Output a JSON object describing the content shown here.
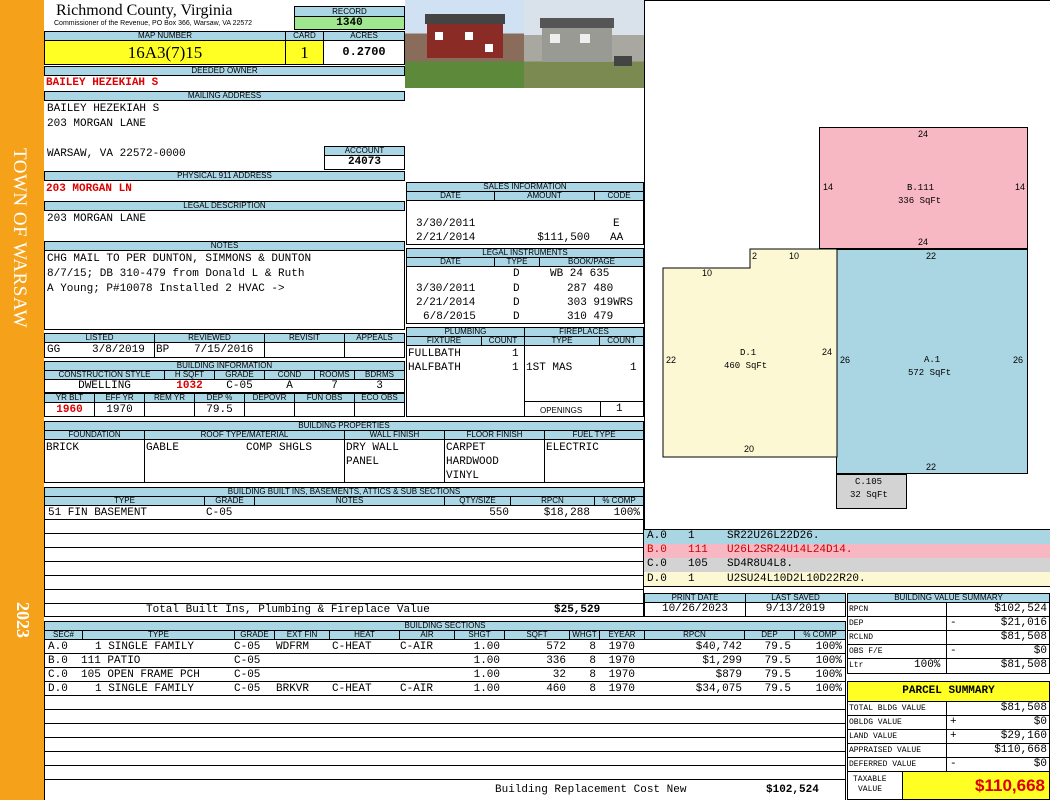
{
  "sidebar": {
    "town": "TOWN OF WARSAW",
    "year": "2023",
    "bg": "#f5a21a"
  },
  "header": {
    "county": "Richmond County, Virginia",
    "office": "Commissioner of the Revenue, PO Box 366, Warsaw, VA 22572",
    "record_label": "RECORD",
    "record": "1340",
    "map_label": "MAP NUMBER",
    "map_number": "16A3(7)15",
    "card_label": "CARD",
    "card": "1",
    "acres_label": "ACRES",
    "acres": "0.2700"
  },
  "owner": {
    "deeded_label": "DEEDED OWNER",
    "deeded": "BAILEY HEZEKIAH S",
    "mailing_label": "MAILING ADDRESS",
    "mailing_line1": "BAILEY HEZEKIAH S",
    "mailing_line2": "203 MORGAN LANE",
    "mailing_line3": "WARSAW, VA 22572-0000",
    "account_label": "ACCOUNT",
    "account": "24073",
    "physical_label": "PHYSICAL 911 ADDRESS",
    "physical": "203 MORGAN LN",
    "legal_label": "LEGAL DESCRIPTION",
    "legal": "203 MORGAN LANE",
    "notes_label": "NOTES",
    "notes_line1": "CHG MAIL TO PER DUNTON, SIMMONS & DUNTON",
    "notes_line2": "8/7/15; DB 310-479 from Donald L & Ruth",
    "notes_line3": "A Young; P#10078 Installed 2 HVAC ->"
  },
  "listing": {
    "listed_label": "LISTED",
    "reviewed_label": "REVIEWED",
    "revisit_label": "REVISIT",
    "appeals_label": "APPEALS",
    "listed_by": "GG",
    "listed_date": "3/8/2019",
    "reviewed_by": "BP",
    "reviewed_date": "7/15/2016"
  },
  "building_info": {
    "title": "BUILDING INFORMATION",
    "h_style": "CONSTRUCTION STYLE",
    "h_sqft": "H SQFT",
    "h_grade": "GRADE",
    "h_cond": "COND",
    "h_rooms": "ROOMS",
    "h_bdrms": "BDRMS",
    "style": "DWELLING",
    "sqft": "1032",
    "grade": "C-05",
    "cond": "A",
    "rooms": "7",
    "bdrms": "3",
    "h_yrblt": "YR BLT",
    "h_effyr": "EFF YR",
    "h_remyr": "REM YR",
    "h_dep": "DEP %",
    "h_depovr": "DEPOVR",
    "h_funobs": "FUN OBS",
    "h_ecoobs": "ECO OBS",
    "yrblt": "1960",
    "effyr": "1970",
    "dep": "79.5"
  },
  "sales": {
    "title": "SALES INFORMATION",
    "h_date": "DATE",
    "h_amount": "AMOUNT",
    "h_code": "CODE",
    "rows": [
      {
        "date": "3/30/2011",
        "amount": "",
        "code": "E"
      },
      {
        "date": "2/21/2014",
        "amount": "$111,500",
        "code": "AA"
      }
    ]
  },
  "legal_instruments": {
    "title": "LEGAL INSTRUMENTS",
    "h_date": "DATE",
    "h_type": "TYPE",
    "h_book": "BOOK/PAGE",
    "rows": [
      {
        "date": "",
        "type": "D",
        "book": "WB 24 635"
      },
      {
        "date": "3/30/2011",
        "type": "D",
        "book": "287 480"
      },
      {
        "date": "2/21/2014",
        "type": "D",
        "book": "303 919WRS"
      },
      {
        "date": "6/8/2015",
        "type": "D",
        "book": "310 479"
      }
    ]
  },
  "plumbing": {
    "title": "PLUMBING",
    "h_fixture": "FIXTURE",
    "h_count": "COUNT",
    "rows": [
      {
        "fixture": "FULLBATH",
        "count": "1"
      },
      {
        "fixture": "HALFBATH",
        "count": "1"
      }
    ]
  },
  "fireplaces": {
    "title": "FIREPLACES",
    "h_type": "TYPE",
    "h_count": "COUNT",
    "rows": [
      {
        "type": "1ST MAS",
        "count": "1"
      }
    ],
    "openings_label": "OPENINGS",
    "openings": "1"
  },
  "properties": {
    "title": "BUILDING PROPERTIES",
    "h_foundation": "FOUNDATION",
    "h_roof": "ROOF TYPE/MATERIAL",
    "h_wall": "WALL FINISH",
    "h_floor": "FLOOR FINISH",
    "h_fuel": "FUEL TYPE",
    "foundation": "BRICK",
    "roof_type": "GABLE",
    "roof_material": "COMP SHGLS",
    "wall1": "DRY WALL",
    "wall2": "PANEL",
    "floor1": "CARPET",
    "floor2": "HARDWOOD",
    "floor3": "VINYL",
    "fuel": "ELECTRIC"
  },
  "builtins": {
    "title": "BUILDING BUILT INS, BASEMENTS, ATTICS & SUB SECTIONS",
    "h_type": "TYPE",
    "h_grade": "GRADE",
    "h_notes": "NOTES",
    "h_qty": "QTY/SIZE",
    "h_rpcn": "RPCN",
    "h_comp": "% COMP",
    "rows": [
      {
        "type": "51 FIN BASEMENT",
        "grade": "C-05",
        "qty": "550",
        "rpcn": "$18,288",
        "comp": "100%"
      }
    ],
    "total_label": "Total Built Ins, Plumbing & Fireplace Value",
    "total": "$25,529"
  },
  "sections": {
    "title": "BUILDING SECTIONS",
    "h_sec": "SEC#",
    "h_type": "TYPE",
    "h_grade": "GRADE",
    "h_extfin": "EXT FIN",
    "h_heat": "HEAT",
    "h_air": "AIR",
    "h_shgt": "SHGT",
    "h_sqft": "SQFT",
    "h_whgt": "WHGT",
    "h_eyear": "EYEAR",
    "h_rpcn": "RPCN",
    "h_dep": "DEP",
    "h_comp": "% COMP",
    "rows": [
      {
        "sec": "A.0",
        "type": "1 SINGLE FAMILY",
        "grade": "C-05",
        "extfin": "WDFRM",
        "heat": "C-HEAT",
        "air": "C-AIR",
        "shgt": "1.00",
        "sqft": "572",
        "whgt": "8",
        "eyear": "1970",
        "rpcn": "$40,742",
        "dep": "79.5",
        "comp": "100%"
      },
      {
        "sec": "B.0",
        "type": "111 PATIO",
        "grade": "C-05",
        "extfin": "",
        "heat": "",
        "air": "",
        "shgt": "1.00",
        "sqft": "336",
        "whgt": "8",
        "eyear": "1970",
        "rpcn": "$1,299",
        "dep": "79.5",
        "comp": "100%"
      },
      {
        "sec": "C.0",
        "type": "105 OPEN FRAME PCH",
        "grade": "C-05",
        "extfin": "",
        "heat": "",
        "air": "",
        "shgt": "1.00",
        "sqft": "32",
        "whgt": "8",
        "eyear": "1970",
        "rpcn": "$879",
        "dep": "79.5",
        "comp": "100%"
      },
      {
        "sec": "D.0",
        "type": "1 SINGLE FAMILY",
        "grade": "C-05",
        "extfin": "BRKVR",
        "heat": "C-HEAT",
        "air": "C-AIR",
        "shgt": "1.00",
        "sqft": "460",
        "whgt": "8",
        "eyear": "1970",
        "rpcn": "$34,075",
        "dep": "79.5",
        "comp": "100%"
      }
    ],
    "total_label": "Building Replacement Cost New",
    "total": "$102,524"
  },
  "sketch": {
    "colors": {
      "b": "#f7b8c3",
      "d": "#fbf8d3",
      "a": "#aad5e3",
      "c": "#d3d3d3"
    },
    "b_label": "B.111",
    "b_area": "336 SqFt",
    "b_top": "24",
    "b_left": "14",
    "b_right": "14",
    "b_bottom": "24",
    "d_label": "D.1",
    "d_area": "460 SqFt",
    "d_10": "10",
    "d_2": "2",
    "d_10b": "10",
    "d_22": "22",
    "d_24": "24",
    "d_20": "20",
    "a_label": "A.1",
    "a_area": "572 SqFt",
    "a_22top": "22",
    "a_26l": "26",
    "a_26r": "26",
    "a_22b": "22",
    "c_label": "C.105",
    "c_area": "32 SqFt",
    "legend": [
      {
        "code": "A.0",
        "num": "1",
        "vec": "SR22U26L22D26.",
        "color": "#aad5e3"
      },
      {
        "code": "B.0",
        "num": "111",
        "vec": "U26L2SR24U14L24D14.",
        "color": "#f7b8c3"
      },
      {
        "code": "C.0",
        "num": "105",
        "vec": "SD4R8U4L8.",
        "color": "#d3d3d3"
      },
      {
        "code": "D.0",
        "num": "1",
        "vec": "U2SU24L10D2L10D22R20.",
        "color": "#fbf8d3"
      }
    ]
  },
  "dates": {
    "print_label": "PRINT DATE",
    "print": "10/26/2023",
    "saved_label": "LAST SAVED",
    "saved": "9/13/2019"
  },
  "value_summary": {
    "title": "BUILDING VALUE SUMMARY",
    "rpcn_label": "RPCN",
    "rpcn": "$102,524",
    "dep_label": "DEP",
    "dep_sign": "-",
    "dep": "$21,016",
    "rclnd_label": "RCLND",
    "rclnd": "$81,508",
    "obs_label": "OBS F/E",
    "obs_sign": "-",
    "obs": "$0",
    "ltr_label": "Ltr",
    "ltr_pct": "100%",
    "ltr": "$81,508"
  },
  "parcel": {
    "title": "PARCEL SUMMARY",
    "bldg_label": "TOTAL BLDG VALUE",
    "bldg": "$81,508",
    "obldg_label": "OBLDG VALUE",
    "obldg_sign": "+",
    "obldg": "$0",
    "land_label": "LAND VALUE",
    "land_sign": "+",
    "land": "$29,160",
    "appraised_label": "APPRAISED VALUE",
    "appraised": "$110,668",
    "deferred_label": "DEFERRED VALUE",
    "deferred_sign": "-",
    "deferred": "$0",
    "taxable_label1": "TAXABLE",
    "taxable_label2": "VALUE",
    "taxable": "$110,668"
  }
}
